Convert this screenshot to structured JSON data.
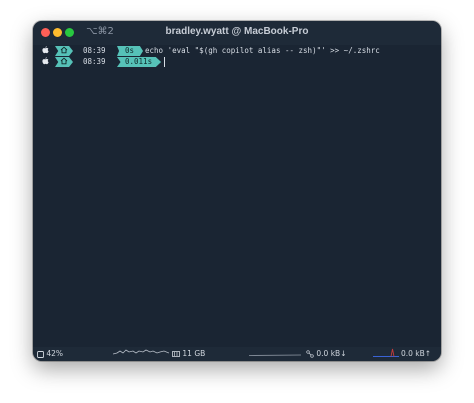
{
  "window": {
    "shortcut": "⌥⌘2",
    "title": "bradley.wyatt @ MacBook-Pro",
    "traffic_lights": {
      "close": "#ff5f57",
      "minimize": "#febc2e",
      "zoom": "#28c840"
    }
  },
  "terminal": {
    "background": "#1a2533",
    "accent": "#56c2b8",
    "lines": [
      {
        "time": "08:39",
        "duration": "0s",
        "command": "echo 'eval \"$(gh copilot alias -- zsh)\"' >> ~/.zshrc"
      },
      {
        "time": "08:39",
        "duration": "0.011s",
        "command": ""
      }
    ]
  },
  "statusbar": {
    "battery": "42%",
    "memory": "11 GB",
    "net_down": "0.0 kB↓",
    "net_up": "0.0 kB↑"
  }
}
